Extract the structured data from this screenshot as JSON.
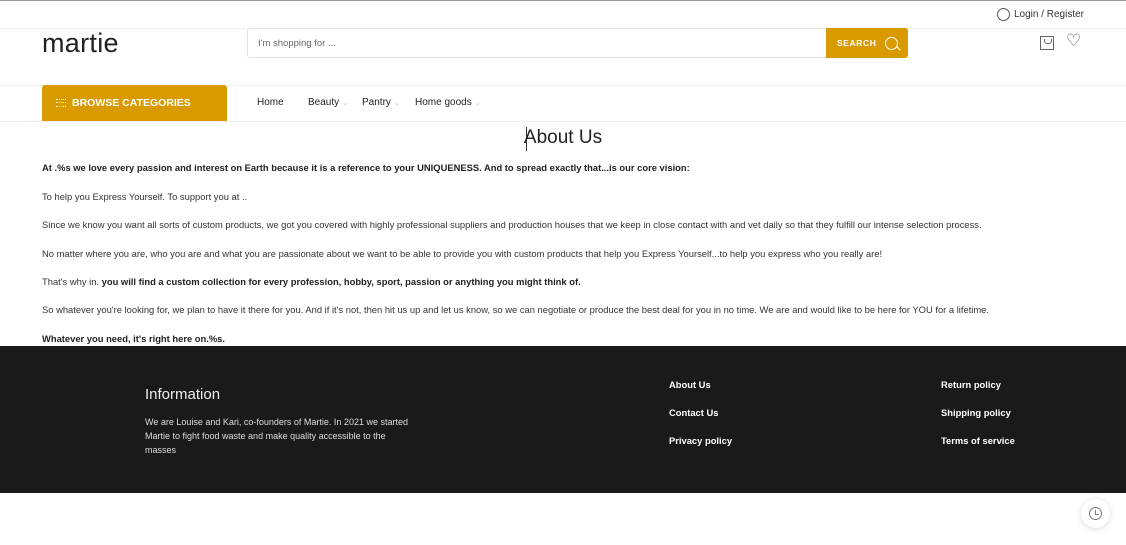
{
  "header": {
    "login_label": "Login / Register",
    "logo": "martie",
    "search_placeholder": "I'm shopping for ...",
    "search_button": "SEARCH",
    "icons": [
      "user-icon",
      "search-icon",
      "shopping-bag-icon",
      "heart-icon"
    ],
    "accent_color": "#d99a00"
  },
  "nav": {
    "browse_label": "BROWSE CATEGORIES",
    "items": [
      {
        "label": "Home"
      },
      {
        "label": "Beauty",
        "has_dropdown": true
      },
      {
        "label": "Pantry",
        "has_dropdown": true
      },
      {
        "label": "Home goods",
        "has_dropdown": true
      }
    ]
  },
  "main": {
    "title": "About Us",
    "paragraphs": [
      "At .%s we love every passion and interest on Earth because it is a reference to your UNIQUENESS. And to spread exactly that...is our core vision:",
      "To help you Express Yourself. To support you at ..",
      "Since we know you want all sorts of custom products, we got you covered with highly professional suppliers and production houses that we keep in close contact with and vet daily so that they fulfill our intense selection process.",
      "No matter where you are, who you are and what you are passionate about we want to be able to provide you with custom products that help you Express Yourself...to help you express who you really are!",
      "So whatever you're looking for, we plan to have it there for you. And if it's not, then hit us up and let us know, so we can negotiate or produce the best deal for you in no time. We are and would like to be here for YOU for a lifetime.",
      "Whatever you need, it's right here on.%s."
    ],
    "p5_prefix": "That's why in.",
    "p5_bold": "you will find a custom collection for every profession, hobby, sport, passion or anything you might think of."
  },
  "footer": {
    "info_title": "Information",
    "info_text": "We are Louise and Kari, co-founders of Martie. In 2021 we started Martie to fight food waste and make quality accessible to the masses",
    "links_col1": [
      "About Us",
      "Contact Us",
      "Privacy policy"
    ],
    "links_col2": [
      "Return policy",
      "Shipping policy",
      "Terms of service"
    ],
    "background_color": "#1b1a1a"
  }
}
